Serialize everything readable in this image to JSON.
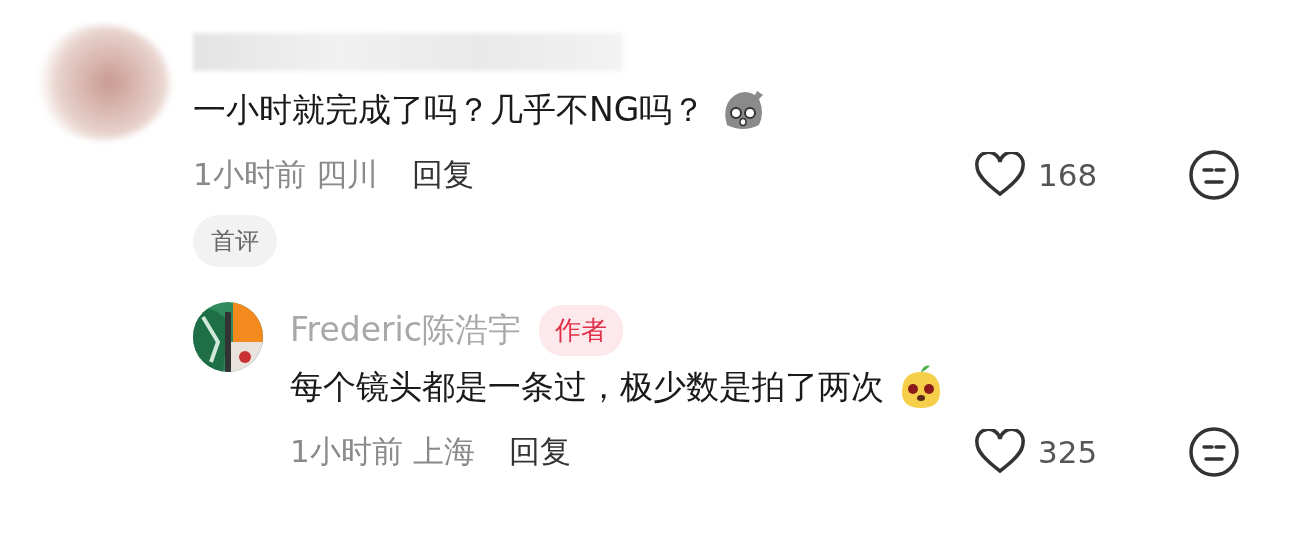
{
  "comment": {
    "content": "一小时就完成了吗？几乎不NG吗？",
    "time_location": "1小时前 四川",
    "reply_label": "回复",
    "likes": "168",
    "tag": "首评",
    "replies": [
      {
        "author": "Frederic陈浩宇",
        "badge": "作者",
        "content": "每个镜头都是一条过，极少数是拍了两次",
        "time_location": "1小时前 上海",
        "reply_label": "回复",
        "likes": "325"
      }
    ]
  }
}
